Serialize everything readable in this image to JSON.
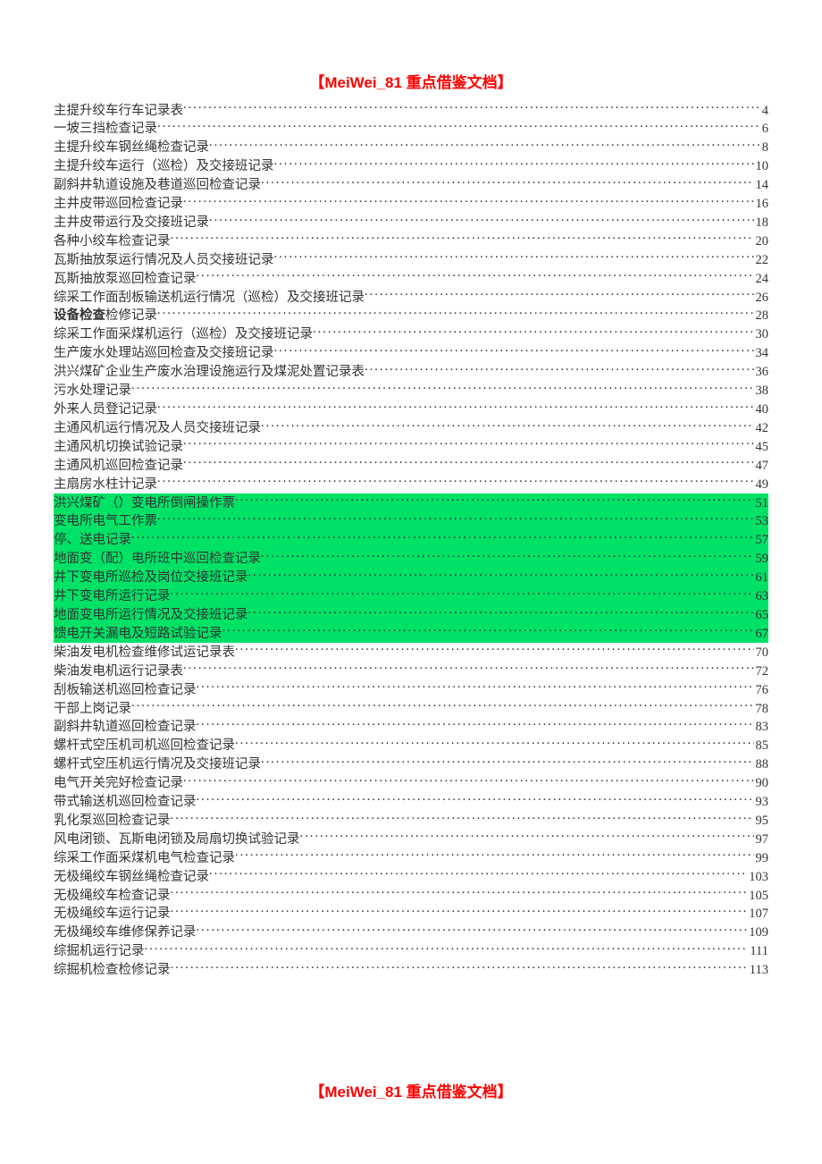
{
  "header": "【MeiWei_81 重点借鉴文档】",
  "footer": "【MeiWei_81 重点借鉴文档】",
  "toc": [
    {
      "title": "主提升绞车行车记录表",
      "page": "4",
      "highlighted": false
    },
    {
      "title": "一坡三挡检查记录",
      "page": "6",
      "highlighted": false
    },
    {
      "title": "主提升绞车钢丝绳检查记录",
      "page": "8",
      "highlighted": false
    },
    {
      "title": "主提升绞车运行（巡检）及交接班记录",
      "page": "10",
      "highlighted": false
    },
    {
      "title": "副斜井轨道设施及巷道巡回检查记录",
      "page": "14",
      "highlighted": false
    },
    {
      "title": "主井皮带巡回检查记录",
      "page": "16",
      "highlighted": false
    },
    {
      "title": "主井皮带运行及交接班记录",
      "page": "18",
      "highlighted": false
    },
    {
      "title": "各种小绞车检查记录",
      "page": "20",
      "highlighted": false
    },
    {
      "title": "瓦斯抽放泵运行情况及人员交接班记录",
      "page": "22",
      "highlighted": false
    },
    {
      "title": "瓦斯抽放泵巡回检查记录",
      "page": "24",
      "highlighted": false
    },
    {
      "title": "综采工作面刮板输送机运行情况（巡检）及交接班记录",
      "page": "26",
      "highlighted": false
    },
    {
      "title": "设备检查检修记录",
      "page": "28",
      "highlighted": false,
      "boldPrefix": "设备检查",
      "restTitle": "检修记录"
    },
    {
      "title": "综采工作面采煤机运行（巡检）及交接班记录",
      "page": "30",
      "highlighted": false
    },
    {
      "title": "生产废水处理站巡回检查及交接班记录",
      "page": "34",
      "highlighted": false
    },
    {
      "title": "洪兴煤矿企业生产废水治理设施运行及煤泥处置记录表",
      "page": "36",
      "highlighted": false
    },
    {
      "title": "污水处理记录",
      "page": "38",
      "highlighted": false
    },
    {
      "title": "外来人员登记记录",
      "page": "40",
      "highlighted": false
    },
    {
      "title": "主通风机运行情况及人员交接班记录",
      "page": "42",
      "highlighted": false
    },
    {
      "title": "主通风机切换试验记录",
      "page": "45",
      "highlighted": false
    },
    {
      "title": "主通风机巡回检查记录",
      "page": "47",
      "highlighted": false
    },
    {
      "title": "主扇房水柱计记录",
      "page": "49",
      "highlighted": false
    },
    {
      "title": "洪兴煤矿（）变电所倒闸操作票",
      "page": "51",
      "highlighted": true
    },
    {
      "title": "变电所电气工作票",
      "page": "53",
      "highlighted": true
    },
    {
      "title": "停、送电记录",
      "page": "57",
      "highlighted": true
    },
    {
      "title": "地面变（配）电所班中巡回检查记录",
      "page": "59",
      "highlighted": true
    },
    {
      "title": "井下变电所巡检及岗位交接班记录",
      "page": "61",
      "highlighted": true
    },
    {
      "title": "井下变电所运行记录",
      "page": "63",
      "highlighted": true
    },
    {
      "title": "地面变电所运行情况及交接班记录",
      "page": "65",
      "highlighted": true
    },
    {
      "title": "馈电开关漏电及短路试验记录",
      "page": "67",
      "highlighted": true
    },
    {
      "title": "柴油发电机检查维修试运记录表",
      "page": "70",
      "highlighted": false
    },
    {
      "title": "柴油发电机运行记录表",
      "page": "72",
      "highlighted": false
    },
    {
      "title": "刮板输送机巡回检查记录",
      "page": "76",
      "highlighted": false
    },
    {
      "title": "干部上岗记录",
      "page": "78",
      "highlighted": false
    },
    {
      "title": "副斜井轨道巡回检查记录",
      "page": "83",
      "highlighted": false
    },
    {
      "title": "螺杆式空压机司机巡回检查记录",
      "page": "85",
      "highlighted": false
    },
    {
      "title": "螺杆式空压机运行情况及交接班记录",
      "page": "88",
      "highlighted": false
    },
    {
      "title": "电气开关完好检查记录",
      "page": "90",
      "highlighted": false
    },
    {
      "title": "带式输送机巡回检查记录",
      "page": "93",
      "highlighted": false
    },
    {
      "title": "乳化泵巡回检查记录",
      "page": "95",
      "highlighted": false
    },
    {
      "title": "风电闭锁、瓦斯电闭锁及局扇切换试验记录",
      "page": "97",
      "highlighted": false
    },
    {
      "title": "综采工作面采煤机电气检查记录",
      "page": "99",
      "highlighted": false
    },
    {
      "title": "无极绳绞车钢丝绳检查记录",
      "page": "103",
      "highlighted": false
    },
    {
      "title": "无极绳绞车检查记录",
      "page": "105",
      "highlighted": false
    },
    {
      "title": "无极绳绞车运行记录",
      "page": "107",
      "highlighted": false
    },
    {
      "title": "无极绳绞车维修保养记录",
      "page": "109",
      "highlighted": false
    },
    {
      "title": "综掘机运行记录",
      "page": "111",
      "highlighted": false
    },
    {
      "title": "综掘机检查检修记录",
      "page": "113",
      "highlighted": false
    }
  ]
}
